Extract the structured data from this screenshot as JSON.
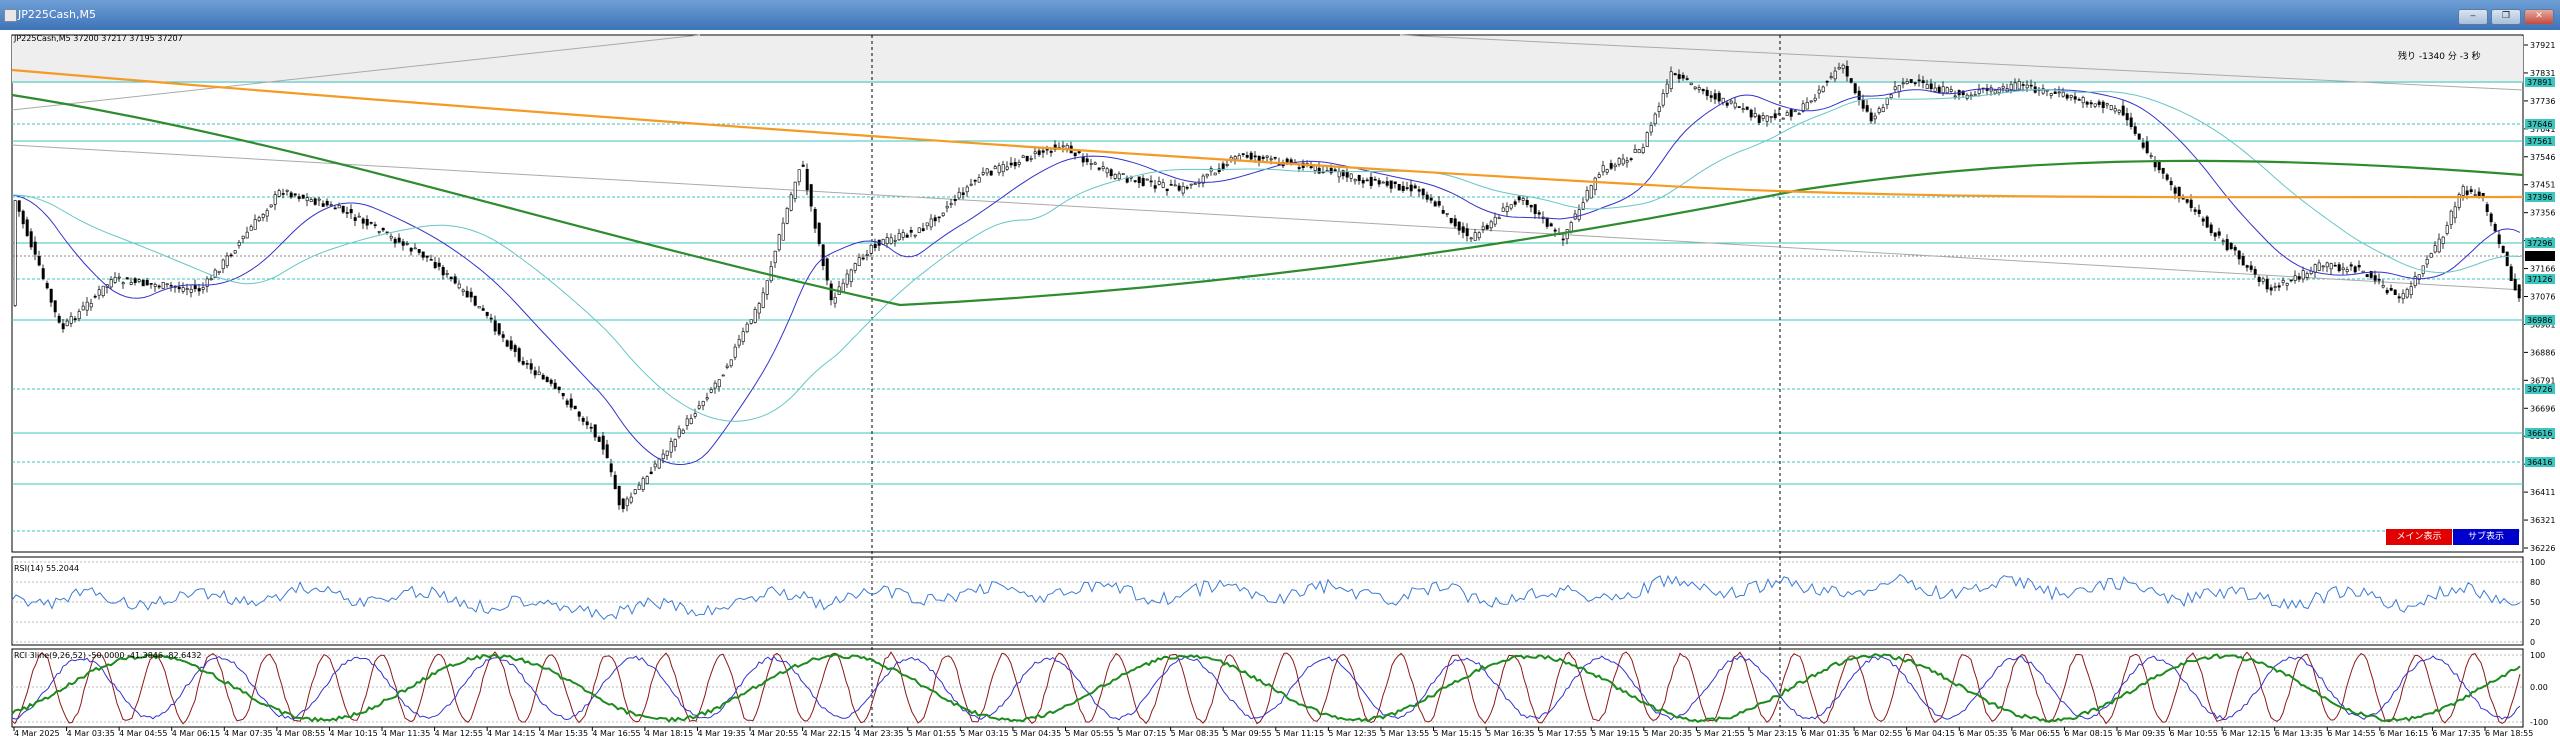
{
  "window": {
    "title": "JP225Cash,M5",
    "buttons": [
      "‒",
      "❐",
      "✕"
    ]
  },
  "chart": {
    "symbol_info": "JP225Cash,M5  37200 37217 37195 37207",
    "spread_info": "残り -1340 分 -3 秒",
    "current_price": "37207",
    "main_button": "メイン表示",
    "sub_button": "サブ表示",
    "colors": {
      "candle": "#000000",
      "ma_orange": "#f59a23",
      "ma_green": "#2e8b2e",
      "ma_blue": "#3333cc",
      "ma_teal": "#66c6c6",
      "level": "#3cc6c0"
    },
    "price_labels": [
      "37921",
      "37831",
      "37736",
      "37641",
      "37546",
      "37451",
      "37356",
      "37261",
      "37166",
      "37076",
      "36981",
      "36886",
      "36791",
      "36696",
      "36601",
      "36506",
      "36411",
      "36321",
      "36226"
    ],
    "level_tags": [
      "37891",
      "37646",
      "37561",
      "37396",
      "37296",
      "37126",
      "36986",
      "36726",
      "36616",
      "36416"
    ],
    "time_labels": [
      "4 Mar 2025",
      "4 Mar 03:35",
      "4 Mar 04:55",
      "4 Mar 06:15",
      "4 Mar 07:35",
      "4 Mar 08:55",
      "4 Mar 10:15",
      "4 Mar 11:35",
      "4 Mar 12:55",
      "4 Mar 14:15",
      "4 Mar 15:35",
      "4 Mar 16:55",
      "4 Mar 18:15",
      "4 Mar 19:35",
      "4 Mar 20:55",
      "4 Mar 22:15",
      "4 Mar 23:35",
      "5 Mar 01:55",
      "5 Mar 03:15",
      "5 Mar 04:35",
      "5 Mar 05:55",
      "5 Mar 07:15",
      "5 Mar 08:35",
      "5 Mar 09:55",
      "5 Mar 11:15",
      "5 Mar 12:35",
      "5 Mar 13:55",
      "5 Mar 15:15",
      "5 Mar 16:35",
      "5 Mar 17:55",
      "5 Mar 19:15",
      "5 Mar 20:35",
      "5 Mar 21:55",
      "5 Mar 23:15",
      "6 Mar 01:35",
      "6 Mar 02:55",
      "6 Mar 04:15",
      "6 Mar 05:35",
      "6 Mar 06:55",
      "6 Mar 08:15",
      "6 Mar 09:35",
      "6 Mar 10:55",
      "6 Mar 12:15",
      "6 Mar 13:35",
      "6 Mar 14:55",
      "6 Mar 16:15",
      "6 Mar 17:35",
      "6 Mar 18:55"
    ]
  },
  "rsi": {
    "label": "RSI(14) 55.2044",
    "scale": [
      "100",
      "80",
      "50",
      "20",
      "0"
    ]
  },
  "rci": {
    "label": "RCI 3line(9,26,52) -50.0000 -41.3846 -82.6432",
    "scale": [
      "100",
      "0.00",
      "-100"
    ]
  }
}
